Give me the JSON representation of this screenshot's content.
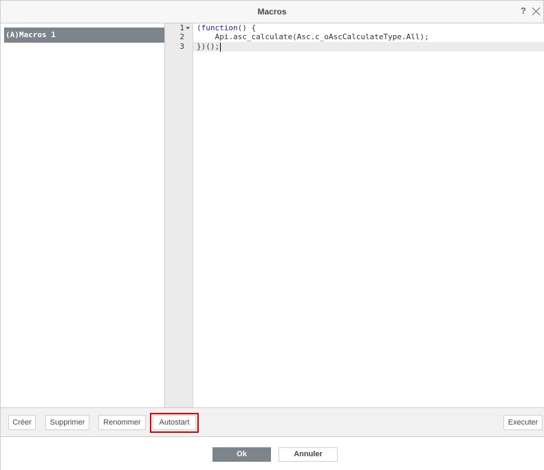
{
  "dialog": {
    "title": "Macros",
    "help_label": "?"
  },
  "macros": {
    "items": [
      {
        "label": "(A)Macros 1"
      }
    ]
  },
  "editor": {
    "line_numbers": [
      "1",
      "2",
      "3"
    ],
    "lines": [
      {
        "parts": [
          "(",
          "function",
          "() {"
        ]
      },
      {
        "text": "    Api.asc_calculate(Asc.c_oAscCalculateType.All);"
      },
      {
        "text": "})();"
      }
    ]
  },
  "toolbar": {
    "create_label": "Créer",
    "delete_label": "Supprimer",
    "rename_label": "Renommer",
    "autostart_label": "Autostart",
    "execute_label": "Executer"
  },
  "footer": {
    "ok_label": "Ok",
    "cancel_label": "Annuler"
  },
  "colors": {
    "accent_gray": "#7d858c",
    "highlight_red": "#e00000",
    "keyword_blue": "#1a1aa6"
  }
}
